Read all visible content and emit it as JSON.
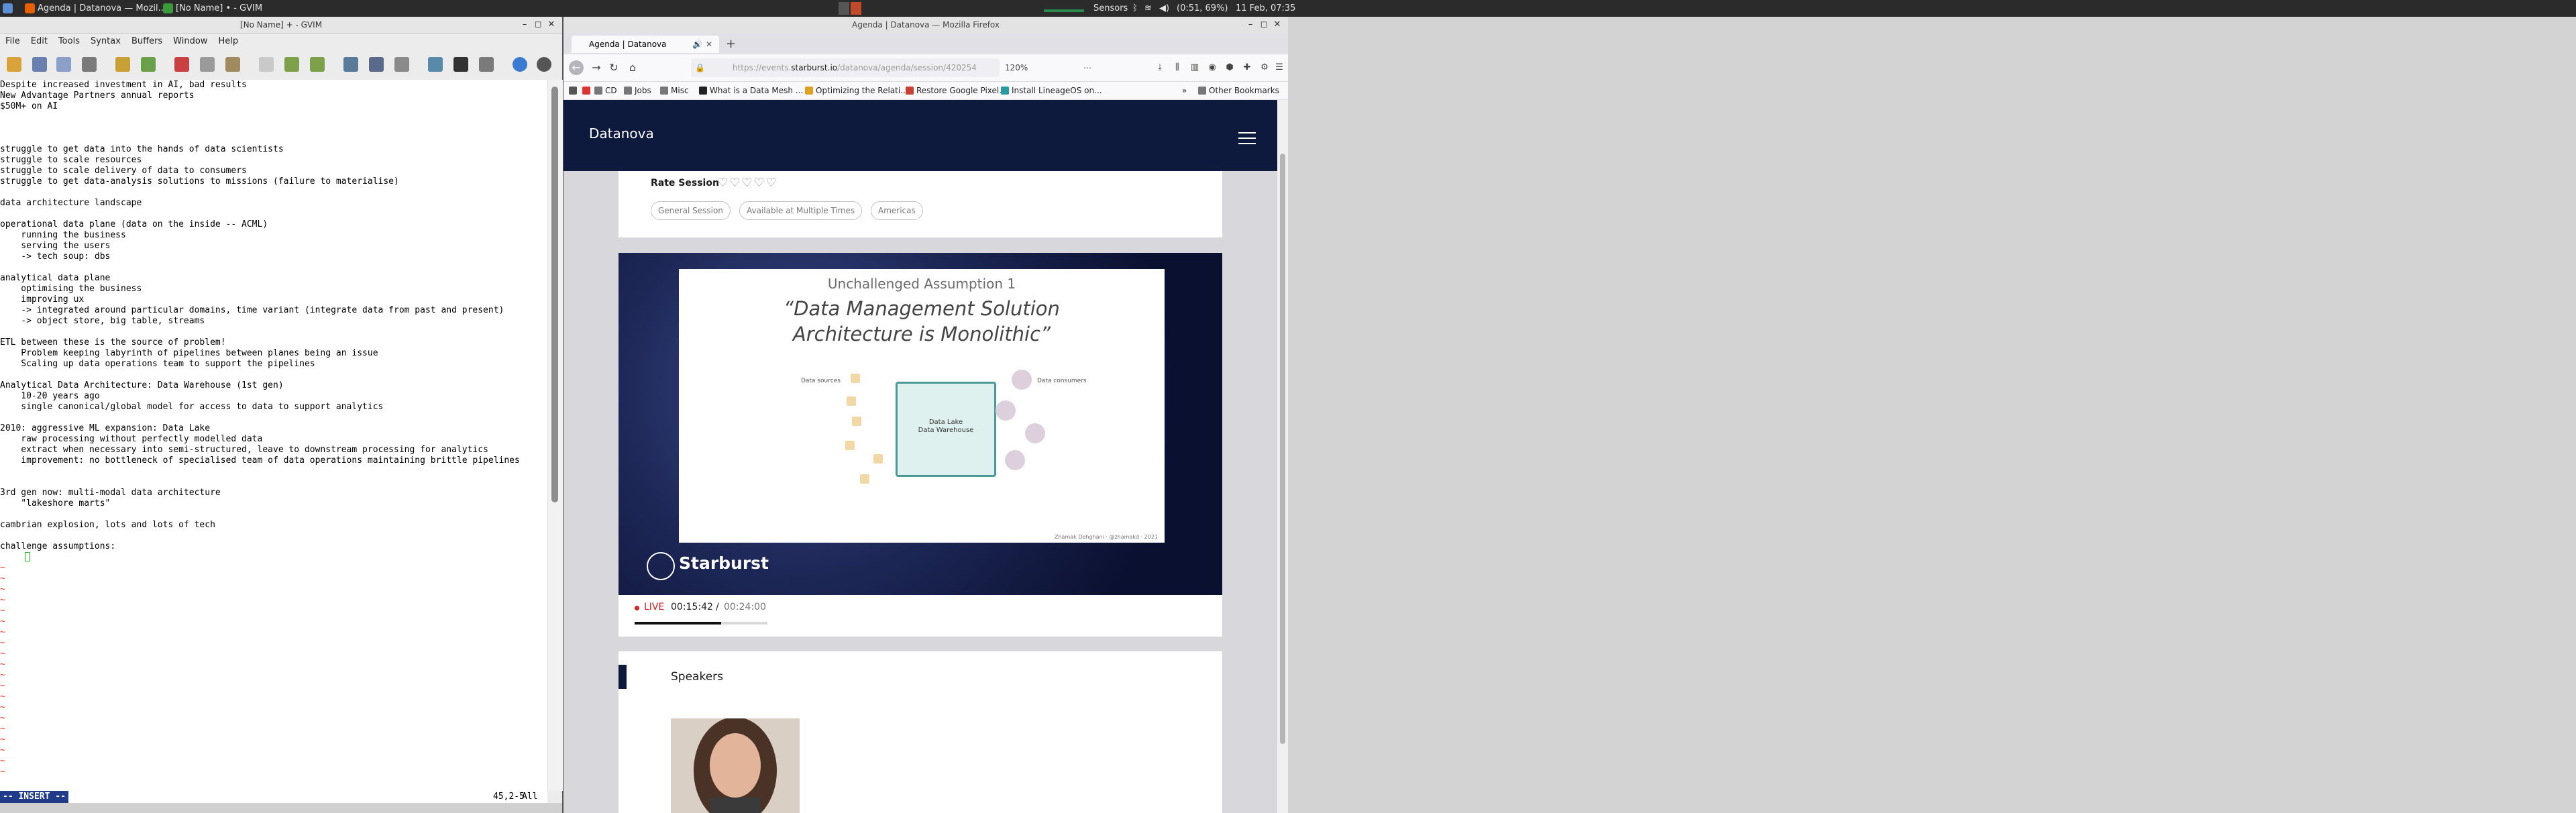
{
  "taskbar": {
    "items": [
      {
        "label": "Agenda | Datanova — Mozil...",
        "icon": "firefox-icon"
      },
      {
        "label": "[No Name] • - GVIM",
        "icon": "vim-icon"
      }
    ],
    "sensors": "Sensors",
    "battery": "(0:51, 69%)",
    "clock": "11 Feb, 07:35"
  },
  "gvim": {
    "title": "[No Name] + - GVIM",
    "menu": [
      "File",
      "Edit",
      "Tools",
      "Syntax",
      "Buffers",
      "Window",
      "Help"
    ],
    "lines": [
      "Despite increased investment in AI, bad results",
      "New Advantage Partners annual reports",
      "$50M+ on AI",
      "",
      "",
      "",
      "struggle to get data into the hands of data scientists",
      "struggle to scale resources",
      "struggle to scale delivery of data to consumers",
      "struggle to get data-analysis solutions to missions (failure to materialise)",
      "",
      "data architecture landscape",
      "",
      "operational data plane (data on the inside -- ACML)",
      "    running the business",
      "    serving the users",
      "    -> tech soup: dbs",
      "",
      "analytical data plane",
      "    optimising the business",
      "    improving ux",
      "    -> integrated around particular domains, time variant (integrate data from past and present)",
      "    -> object store, big table, streams",
      "",
      "ETL between these is the source of problem!",
      "    Problem keeping labyrinth of pipelines between planes being an issue",
      "    Scaling up data operations team to support the pipelines",
      "",
      "Analytical Data Architecture: Data Warehouse (1st gen)",
      "    10-20 years ago",
      "    single canonical/global model for access to data to support analytics",
      "",
      "2010: aggressive ML expansion: Data Lake",
      "    raw processing without perfectly modelled data",
      "    extract when necessary into semi-structured, leave to downstream processing for analytics",
      "    improvement: no bottleneck of specialised team of data operations maintaining brittle pipelines",
      "",
      "",
      "3rd gen now: multi-modal data architecture",
      "    \"lakeshore marts\"",
      "",
      "cambrian explosion, lots and lots of tech",
      "",
      "challenge assumptions:"
    ],
    "tilde_count": 20,
    "mode": "-- INSERT --",
    "position": "45,2-5",
    "percent": "All"
  },
  "firefox": {
    "window_title": "Agenda | Datanova — Mozilla Firefox",
    "tab_label": "Agenda | Datanova",
    "url_prefix": "https://events.",
    "url_host": "starburst.io",
    "url_path": "/datanova/agenda/session/420254",
    "zoom": "120%",
    "bookmarks": [
      {
        "label": "CD"
      },
      {
        "label": "Jobs"
      },
      {
        "label": "Misc"
      },
      {
        "label": "What is a Data Mesh ..."
      },
      {
        "label": "Optimizing the Relati..."
      },
      {
        "label": "Restore Google Pixel..."
      },
      {
        "label": "Install LineageOS on..."
      }
    ],
    "other_bookmarks": "Other Bookmarks"
  },
  "site": {
    "brand": "Datanova",
    "rate_label": "Rate Session",
    "stars": "♡♡♡♡♡",
    "tags": [
      "General Session",
      "Available at Multiple Times",
      "Americas"
    ],
    "slide": {
      "subtitle": "Unchallenged Assumption 1",
      "title": "“Data Management Solution Architecture is Monolithic”",
      "sources_label": "Data sources",
      "consumers_label": "Data consumers",
      "box_label_1": "Data Lake",
      "box_label_2": "Data Warehouse",
      "credit": "Zhamak Dehghani · @zhamakd · 2021"
    },
    "video_brand": "Starburst",
    "live": "LIVE",
    "current_time": "00:15:42",
    "separator": "/",
    "duration": "00:24:00",
    "progress": 0.654,
    "speakers_title": "Speakers"
  }
}
